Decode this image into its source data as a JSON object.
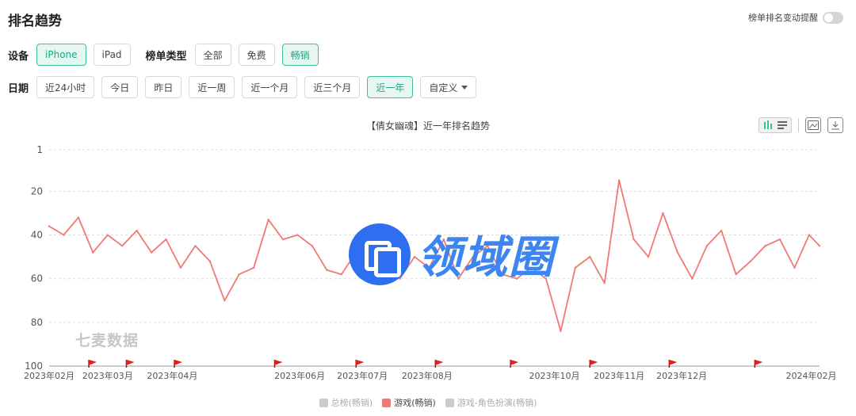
{
  "page": {
    "title": "排名趋势",
    "alert_label": "榜单排名变动提醒"
  },
  "filters": {
    "device_label": "设备",
    "devices": [
      {
        "label": "iPhone",
        "active": true
      },
      {
        "label": "iPad",
        "active": false
      }
    ],
    "chart_type_label": "榜单类型",
    "chart_types": [
      {
        "label": "全部",
        "active": false
      },
      {
        "label": "免费",
        "active": false
      },
      {
        "label": "畅销",
        "active": true
      }
    ],
    "date_label": "日期",
    "dates": [
      {
        "label": "近24小时",
        "active": false
      },
      {
        "label": "今日",
        "active": false
      },
      {
        "label": "昨日",
        "active": false
      },
      {
        "label": "近一周",
        "active": false
      },
      {
        "label": "近一个月",
        "active": false
      },
      {
        "label": "近三个月",
        "active": false
      },
      {
        "label": "近一年",
        "active": true
      }
    ],
    "custom_label": "自定义"
  },
  "watermarks": {
    "brand": "领域圈",
    "source": "七麦数据"
  },
  "icons": [
    "bar-chart-icon",
    "list-icon",
    "image-download-icon",
    "download-icon"
  ],
  "colors": {
    "series": "#f07a72",
    "accent": "#3cbfa0",
    "flag": "#e02020"
  },
  "chart_data": {
    "type": "line",
    "title": "【倩女幽魂】近一年排名趋势",
    "y_ticks": [
      1,
      20,
      40,
      60,
      80,
      100
    ],
    "y_reversed": true,
    "ylim": [
      1,
      100
    ],
    "x_ticks": [
      "2023年02月",
      "2023年03月",
      "2023年04月",
      "2023年06月",
      "2023年07月",
      "2023年08月",
      "2023年10月",
      "2023年11月",
      "2023年12月",
      "2024年02月"
    ],
    "grid": true,
    "legend": [
      {
        "name": "总榜(畅销)",
        "active": false
      },
      {
        "name": "游戏(畅销)",
        "active": true
      },
      {
        "name": "游戏-角色扮演(畅销)",
        "active": false
      }
    ],
    "series": [
      {
        "name": "游戏(畅销)",
        "x": [
          "2023-02-01",
          "2023-02-08",
          "2023-02-15",
          "2023-02-22",
          "2023-03-01",
          "2023-03-08",
          "2023-03-15",
          "2023-03-22",
          "2023-03-29",
          "2023-04-05",
          "2023-04-12",
          "2023-04-19",
          "2023-04-26",
          "2023-05-03",
          "2023-05-10",
          "2023-05-17",
          "2023-05-24",
          "2023-05-31",
          "2023-06-07",
          "2023-06-14",
          "2023-06-21",
          "2023-06-28",
          "2023-07-05",
          "2023-07-12",
          "2023-07-19",
          "2023-07-26",
          "2023-08-02",
          "2023-08-09",
          "2023-08-16",
          "2023-08-23",
          "2023-08-30",
          "2023-09-06",
          "2023-09-13",
          "2023-09-20",
          "2023-09-27",
          "2023-10-04",
          "2023-10-11",
          "2023-10-18",
          "2023-10-25",
          "2023-11-01",
          "2023-11-08",
          "2023-11-15",
          "2023-11-22",
          "2023-11-29",
          "2023-12-06",
          "2023-12-13",
          "2023-12-20",
          "2023-12-27",
          "2024-01-03",
          "2024-01-10",
          "2024-01-17",
          "2024-01-24",
          "2024-01-31",
          "2024-02-05"
        ],
        "values": [
          36,
          40,
          32,
          48,
          40,
          45,
          38,
          48,
          42,
          55,
          45,
          52,
          70,
          58,
          55,
          33,
          42,
          40,
          45,
          56,
          58,
          48,
          58,
          55,
          60,
          50,
          55,
          42,
          60,
          50,
          45,
          58,
          60,
          55,
          60,
          84,
          55,
          50,
          62,
          15,
          42,
          50,
          30,
          48,
          60,
          45,
          38,
          58,
          52,
          45,
          42,
          55,
          40,
          45
        ]
      }
    ],
    "event_flags": [
      "2023-02-20",
      "2023-03-10",
      "2023-04-02",
      "2023-05-20",
      "2023-06-28",
      "2023-08-05",
      "2023-09-10",
      "2023-10-18",
      "2023-11-25",
      "2024-01-05"
    ]
  }
}
